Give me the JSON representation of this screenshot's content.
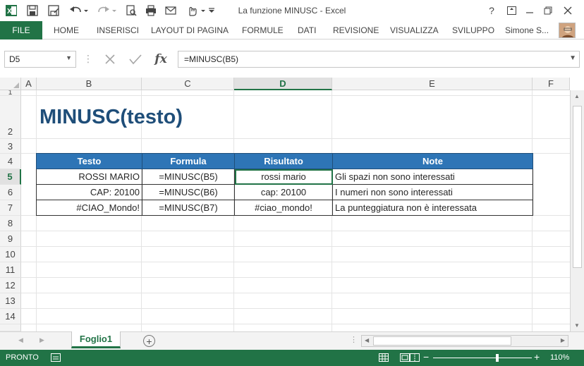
{
  "window": {
    "title": "La funzione MINUSC - Excel",
    "controls": [
      "?",
      "◻",
      "—",
      "◻",
      "✕"
    ]
  },
  "ribbon": {
    "file": "FILE",
    "tabs": [
      "HOME",
      "INSERISCI",
      "LAYOUT DI PAGINA",
      "FORMULE",
      "DATI",
      "REVISIONE",
      "VISUALIZZA",
      "SVILUPPO"
    ],
    "user": "Simone S..."
  },
  "formula_bar": {
    "name_box": "D5",
    "fx": "fx",
    "formula": "=MINUSC(B5)"
  },
  "grid": {
    "columns": [
      "A",
      "B",
      "C",
      "D",
      "E",
      "F"
    ],
    "selected_column": "D",
    "rows": [
      "1",
      "2",
      "3",
      "4",
      "5",
      "6",
      "7",
      "8",
      "9",
      "10",
      "11",
      "12",
      "13",
      "14"
    ],
    "selected_row": "5"
  },
  "sheet": {
    "title": "MINUSC(testo)",
    "table": {
      "headers": [
        "Testo",
        "Formula",
        "Risultato",
        "Note"
      ],
      "rows": [
        [
          "ROSSI MARIO",
          "=MINUSC(B5)",
          "rossi mario",
          "Gli spazi non sono interessati"
        ],
        [
          "CAP: 20100",
          "=MINUSC(B6)",
          "cap: 20100",
          "I numeri non sono interessati"
        ],
        [
          "#CIAO_Mondo!",
          "=MINUSC(B7)",
          "#ciao_mondo!",
          "La punteggiatura non è interessata"
        ]
      ]
    }
  },
  "tabs_bar": {
    "sheet_tab": "Foglio1",
    "add_sheet": "+"
  },
  "status": {
    "text": "PRONTO",
    "zoom_minus": "−",
    "zoom_plus": "+",
    "zoom": "110%"
  },
  "colors": {
    "accent": "#217346",
    "header_fill": "#2e75b6",
    "title_color": "#1f4e79"
  }
}
